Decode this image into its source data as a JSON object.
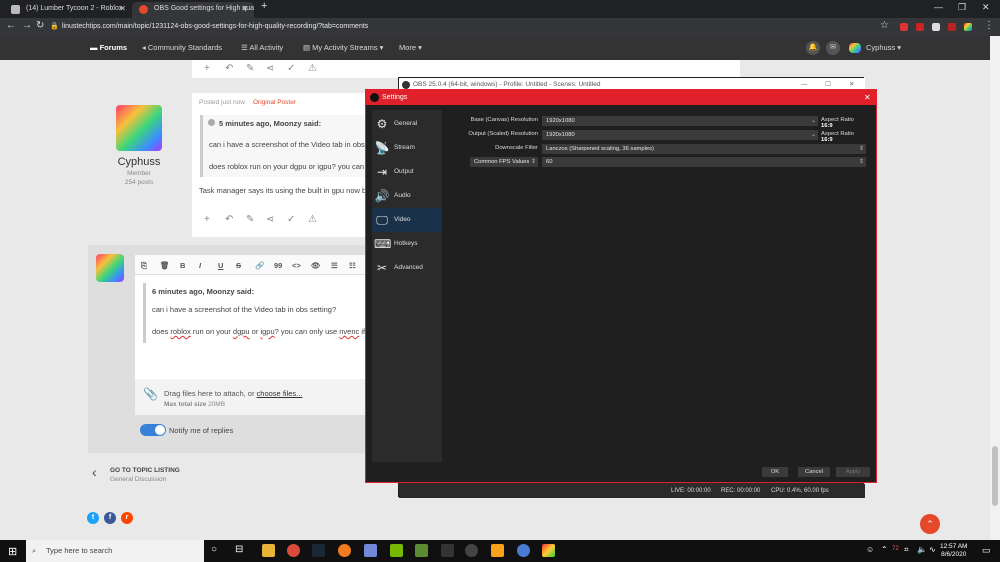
{
  "browser": {
    "tabs": [
      {
        "label": "(14) Lumber Tycoon 2 - Roblox",
        "active": false
      },
      {
        "label": "OBS Good settings for High qua",
        "active": true
      }
    ],
    "new_tab": "+",
    "url": "linustechtips.com/main/topic/1231124-obs-good-settings-for-high-quality-recording/?tab=comments"
  },
  "forum_nav": {
    "items": [
      {
        "label": "Forums",
        "active": true
      },
      {
        "label": "Community Standards"
      },
      {
        "label": "All Activity"
      },
      {
        "label": "My Activity Streams ▾"
      },
      {
        "label": "More ▾"
      }
    ],
    "user": "Cyphuss ▾"
  },
  "post": {
    "meta": "Posted just now",
    "badge": "Original Poster",
    "author": "Cyphuss",
    "role": "Member",
    "posts": "254 posts",
    "quote_head": "5 minutes ago, Moonzy said:",
    "quote_line1": "can i have a screenshot of the Video tab in obs s",
    "quote_line2": "does roblox run on your dgpu or igpu? you can o",
    "reply_text": "Task manager says its using the built in gpu now bu"
  },
  "editor": {
    "toolbar": [
      "⎘",
      "🗑",
      "B",
      "I",
      "U",
      "S",
      "🔗",
      "99",
      "<>",
      "👁",
      "☰",
      "☷"
    ],
    "quote_head": "6 minutes ago, Moonzy said:",
    "quote_line1": "can i have a screenshot of the Video tab in obs setting?",
    "quote_line2_pre": "does ",
    "quote_w1": "roblox",
    "quote_mid1": " run on your ",
    "quote_w2": "dgpu",
    "quote_mid2": " or ",
    "quote_w3": "igpu",
    "quote_mid3": "? you can only use ",
    "quote_w4": "nvenc",
    "quote_end": " if th",
    "attach_pre": "Drag files here to attach, or ",
    "attach_link": "choose files...",
    "max_label": "Max total size",
    "max_value": "20MB",
    "notify": "Notify me of replies"
  },
  "footer": {
    "goto_label": "GO TO TOPIC LISTING",
    "goto_sub": "General Discussion"
  },
  "obs_main": {
    "title": "OBS 25.0.4 (64-bit, windows) - Profile: Untitled - Scenes: Untitled",
    "live": "LIVE: 00:00:00",
    "rec": "REC: 00:00:00",
    "cpu": "CPU: 0.4%, 60.00 fps"
  },
  "settings": {
    "title": "Settings",
    "sidebar": [
      {
        "label": "General",
        "icon": "gear-icon",
        "selected": false
      },
      {
        "label": "Stream",
        "icon": "stream-icon",
        "selected": false
      },
      {
        "label": "Output",
        "icon": "output-icon",
        "selected": false
      },
      {
        "label": "Audio",
        "icon": "speaker-icon",
        "selected": false
      },
      {
        "label": "Video",
        "icon": "monitor-icon",
        "selected": true
      },
      {
        "label": "Hotkeys",
        "icon": "keyboard-icon",
        "selected": false
      },
      {
        "label": "Advanced",
        "icon": "tools-icon",
        "selected": false
      }
    ],
    "base_label": "Base (Canvas) Resolution",
    "base_value": "1920x1080",
    "output_label": "Output (Scaled) Resolution",
    "output_value": "1920x1080",
    "aspect_label": "Aspect Ratio",
    "aspect_value": "16:9",
    "filter_label": "Downscale Filter",
    "filter_value": "Lanczos (Sharpened scaling, 36 samples)",
    "fps_label": "Common FPS Values",
    "fps_value": "60",
    "ok": "OK",
    "cancel": "Cancel",
    "apply": "Apply"
  },
  "taskbar": {
    "search_placeholder": "Type here to search",
    "volume": "72",
    "time": "12:57 AM",
    "date": "8/6/2020"
  }
}
